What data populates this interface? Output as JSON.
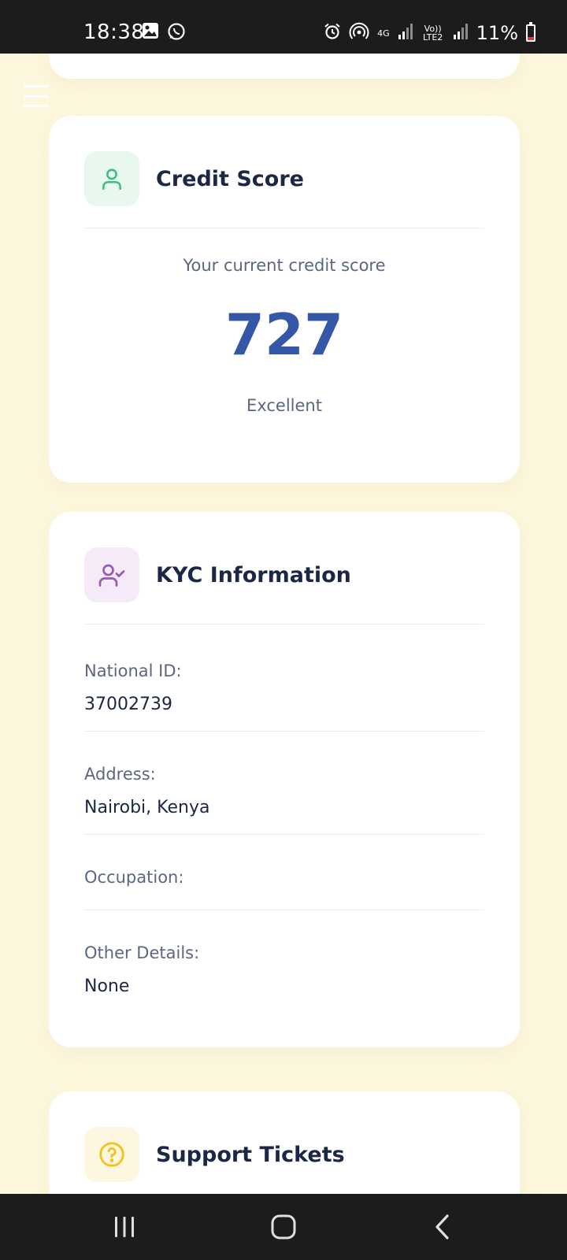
{
  "status_bar": {
    "time": "18:38",
    "battery": "11%",
    "network_label": "4G",
    "volte_label": "Vo)) LTE2"
  },
  "credit_card": {
    "title": "Credit Score",
    "icon": "user-icon",
    "subtitle": "Your current credit score",
    "score": "727",
    "rating": "Excellent",
    "accent": "#3457a8",
    "icon_color": "#3cbf7f"
  },
  "kyc_card": {
    "title": "KYC Information",
    "icon": "user-check-icon",
    "icon_color": "#9b59b6",
    "fields": [
      {
        "label": "National ID:",
        "value": "37002739"
      },
      {
        "label": "Address:",
        "value": "Nairobi, Kenya"
      },
      {
        "label": "Occupation:",
        "value": ""
      },
      {
        "label": "Other Details:",
        "value": "None"
      }
    ]
  },
  "support_card": {
    "title": "Support Tickets",
    "icon": "help-circle-icon",
    "icon_color": "#f2c318"
  },
  "colors": {
    "background": "#fdf7dd",
    "card": "#ffffff",
    "title_text": "#1b2744",
    "muted_text": "#5b6680"
  }
}
